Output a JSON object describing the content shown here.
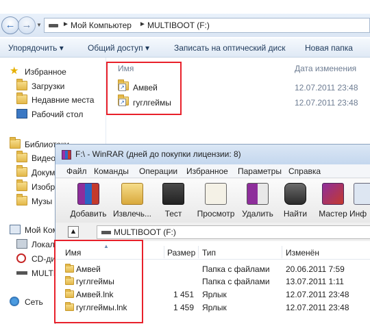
{
  "explorer": {
    "breadcrumb": [
      "Мой Компьютер",
      "MULTIBOOT (F:)"
    ],
    "commands": [
      "Упорядочить ▾",
      "Общий доступ ▾",
      "Записать на оптический диск",
      "Новая папка"
    ],
    "nav": {
      "favorites_title": "Избранное",
      "favorites": [
        "Загрузки",
        "Недавние места",
        "Рабочий стол"
      ],
      "libraries_title": "Библиотеки",
      "libraries": [
        "Видео",
        "Докум",
        "Изобр",
        "Музы"
      ],
      "computer_title": "Мой Компь",
      "computer": [
        "Локал",
        "CD-ди",
        "MULTI"
      ],
      "network": "Сеть"
    },
    "columns": {
      "name": "Имя",
      "date": "Дата изменения"
    },
    "files": [
      {
        "name": "Амвей",
        "date": "12.07.2011 23:48"
      },
      {
        "name": "гуглгеймы",
        "date": "12.07.2011 23:48"
      }
    ]
  },
  "winrar": {
    "title": "F:\\ - WinRAR (дней до покупки лицензии: 8)",
    "menu": [
      "Файл",
      "Команды",
      "Операции",
      "Избранное",
      "Параметры",
      "Справка"
    ],
    "toolbar": [
      "Добавить",
      "Извлечь...",
      "Тест",
      "Просмотр",
      "Удалить",
      "Найти",
      "Мастер",
      "Инф"
    ],
    "path": "MULTIBOOT (F:)",
    "columns": {
      "name": "Имя",
      "size": "Размер",
      "type": "Тип",
      "modified": "Изменён"
    },
    "rows": [
      {
        "name": "Амвей",
        "size": "",
        "type": "Папка с файлами",
        "modified": "20.06.2011 7:59"
      },
      {
        "name": "гуглгеймы",
        "size": "",
        "type": "Папка с файлами",
        "modified": "13.07.2011 1:11"
      },
      {
        "name": "Амвей.lnk",
        "size": "1 451",
        "type": "Ярлык",
        "modified": "12.07.2011 23:48"
      },
      {
        "name": "гуглгеймы.lnk",
        "size": "1 459",
        "type": "Ярлык",
        "modified": "12.07.2011 23:48"
      }
    ]
  },
  "colors": {
    "highlight": "#e8202a",
    "explorer_accent": "#1e395b"
  }
}
